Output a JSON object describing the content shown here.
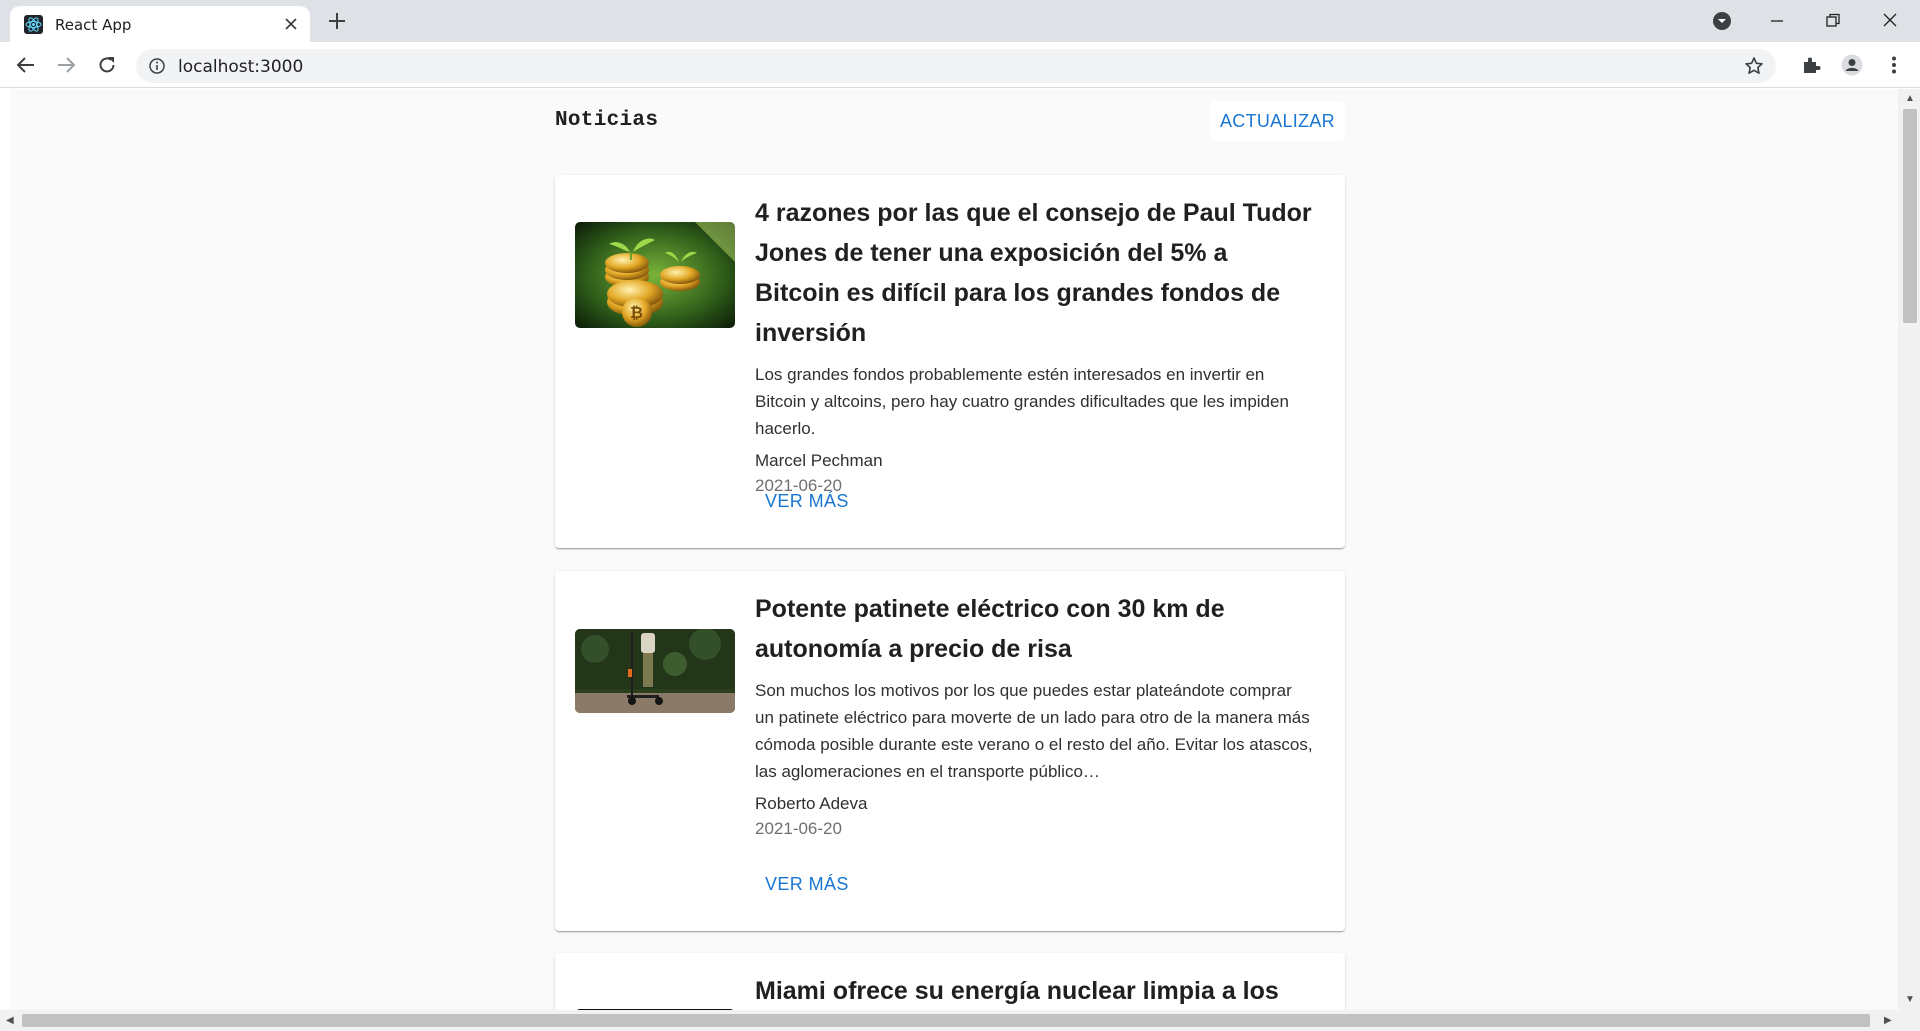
{
  "browser": {
    "tab_title": "React App",
    "url": "localhost:3000"
  },
  "page": {
    "title": "Noticias",
    "refresh_label": "ACTUALIZAR"
  },
  "articles": [
    {
      "title": "4 razones por las que el consejo de Paul Tudor Jones de tener una exposición del 5% a Bitcoin es difícil para los grandes fondos de inversión",
      "description": "Los grandes fondos probablemente estén interesados en invertir en Bitcoin y altcoins, pero hay cuatro grandes dificultades que les impiden hacerlo.",
      "author": "Marcel Pechman",
      "date": "2021-06-20",
      "more_label": "VER MÁS",
      "image": "bitcoin-coins-plant-image"
    },
    {
      "title": "Potente patinete eléctrico con 30 km de autonomía a precio de risa",
      "description": "Son muchos los motivos por los que puedes estar plateándote comprar un patinete eléctrico para moverte de un lado para otro de la manera más cómoda posible durante este verano o el resto del año. Evitar los atascos, las aglomeraciones en el transporte público…",
      "author": "Roberto Adeva",
      "date": "2021-06-20",
      "more_label": "VER MÁS",
      "image": "electric-scooter-image"
    },
    {
      "title": "Miami ofrece su energía nuclear limpia a los"
    }
  ]
}
